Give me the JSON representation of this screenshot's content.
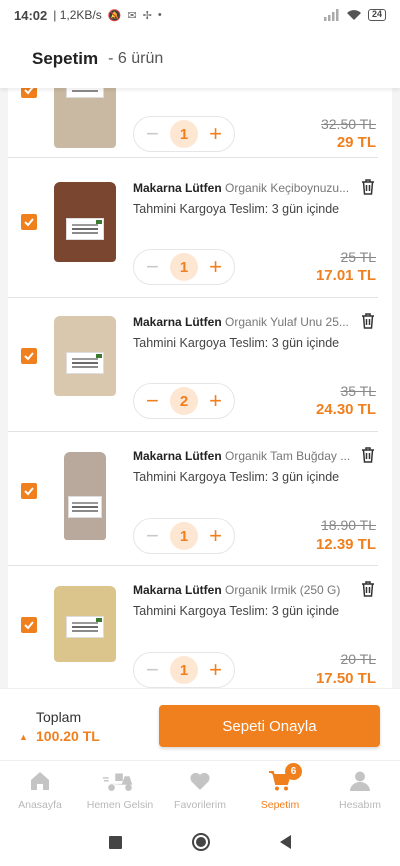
{
  "status_bar": {
    "time": "14:02",
    "speed": "| 1,2KB/s",
    "battery": "24"
  },
  "header": {
    "title": "Sepetim",
    "count": "- 6 ürün"
  },
  "cart_items": [
    {
      "brand": "",
      "name": "",
      "delivery": "",
      "quantity": "1",
      "old_price": "32.50 TL",
      "new_price": "29 TL",
      "bag_color": "#c9b9a2"
    },
    {
      "brand": "Makarna Lütfen",
      "name": "Organik Keçiboynuzu...",
      "delivery": "Tahmini Kargoya Teslim: 3 gün içinde",
      "quantity": "1",
      "old_price": "25 TL",
      "new_price": "17.01 TL",
      "bag_color": "#7a4630"
    },
    {
      "brand": "Makarna Lütfen",
      "name": "Organik Yulaf Unu 25...",
      "delivery": "Tahmini Kargoya Teslim: 3 gün içinde",
      "quantity": "2",
      "old_price": "35 TL",
      "new_price": "24.30 TL",
      "bag_color": "#d9c8ad"
    },
    {
      "brand": "Makarna Lütfen",
      "name": "Organik Tam Buğday ...",
      "delivery": "Tahmini Kargoya Teslim: 3 gün içinde",
      "quantity": "1",
      "old_price": "18.90 TL",
      "new_price": "12.39 TL",
      "bag_color": "#b8a99c"
    },
    {
      "brand": "Makarna Lütfen",
      "name": "Organik Irmik (250 G)",
      "delivery": "Tahmini Kargoya Teslim: 3 gün içinde",
      "quantity": "1",
      "old_price": "20 TL",
      "new_price": "17.50 TL",
      "bag_color": "#dcc48d"
    }
  ],
  "footer": {
    "total_label": "Toplam",
    "total_value": "100.20 TL",
    "confirm_label": "Sepeti Onayla"
  },
  "tabs": [
    {
      "label": "Anasayfa",
      "icon": "home-icon"
    },
    {
      "label": "Hemen Gelsin",
      "icon": "scooter-icon"
    },
    {
      "label": "Favorilerim",
      "icon": "heart-icon"
    },
    {
      "label": "Sepetim",
      "icon": "cart-icon",
      "badge": "6"
    },
    {
      "label": "Hesabım",
      "icon": "person-icon"
    }
  ],
  "colors": {
    "accent": "#f07f1e",
    "accent_light": "#fde6d2",
    "inactive": "#b8b8b8"
  }
}
